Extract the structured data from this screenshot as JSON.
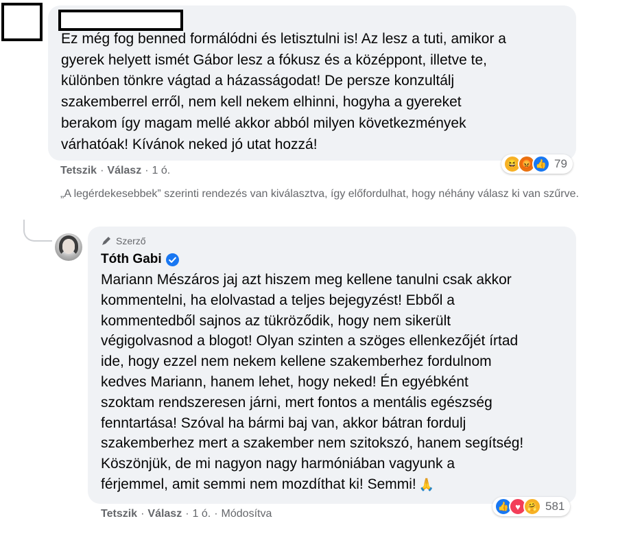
{
  "comment1": {
    "text": "Ez még fog benned formálódni és letisztulni is! Az lesz a tuti, amikor a\ngyerek helyett ismét Gábor lesz a fókusz és a középpont, illetve te,\nkülönben tönkre vágtad a házasságodat! De persze konzultálj\nszakemberrel erről, nem kell nekem elhinni, hogyha a gyereket\nberakom így magam mellé akkor abból milyen következmények\nvárhatóak! Kívánok neked jó utat hozzá!",
    "actions": {
      "like": "Tetszik",
      "reply": "Válasz",
      "time": "1 ó."
    },
    "reactions": {
      "icons": [
        "haha-icon",
        "angry-icon",
        "like-icon"
      ],
      "count": "79"
    }
  },
  "sort_note": "„A legérdekesebbek” szerinti rendezés van kiválasztva, így előfordulhat, hogy néhány válasz ki van szűrve.",
  "reply": {
    "author_tag": "Szerző",
    "author_name": "Tóth Gabi",
    "text": "Mariann Mészáros jaj azt hiszem meg kellene tanulni csak akkor\nkommentelni, ha elolvastad a teljes bejegyzést! Ebből a\nkommentedből sajnos az tükröződik, hogy nem sikerült\nvégigolvasnod a blogot! Olyan szinten a szöges ellenkezőjét írtad\nide, hogy ezzel nem nekem kellene szakemberhez fordulnom\nkedves Mariann, hanem lehet, hogy neked! Én egyébként\nszoktam rendszeresen járni, mert fontos a mentális egészség\nfenntartása! Szóval ha bármi baj van, akkor bátran fordulj\nszakemberhez mert a szakember nem szitokszó, hanem segítség!\nKöszönjük, de mi nagyon nagy harmóniában vagyunk a\nférjemmel, amit semmi nem mozdíthat ki! Semmi!",
    "actions": {
      "like": "Tetszik",
      "reply": "Válasz",
      "time": "1 ó.",
      "edited": "Módosítva"
    },
    "reactions": {
      "icons": [
        "like-icon",
        "love-icon",
        "care-icon"
      ],
      "count": "581"
    }
  },
  "colors": {
    "bubble": "#f0f2f5",
    "meta_text": "#65676b",
    "verified": "#1877f2"
  }
}
